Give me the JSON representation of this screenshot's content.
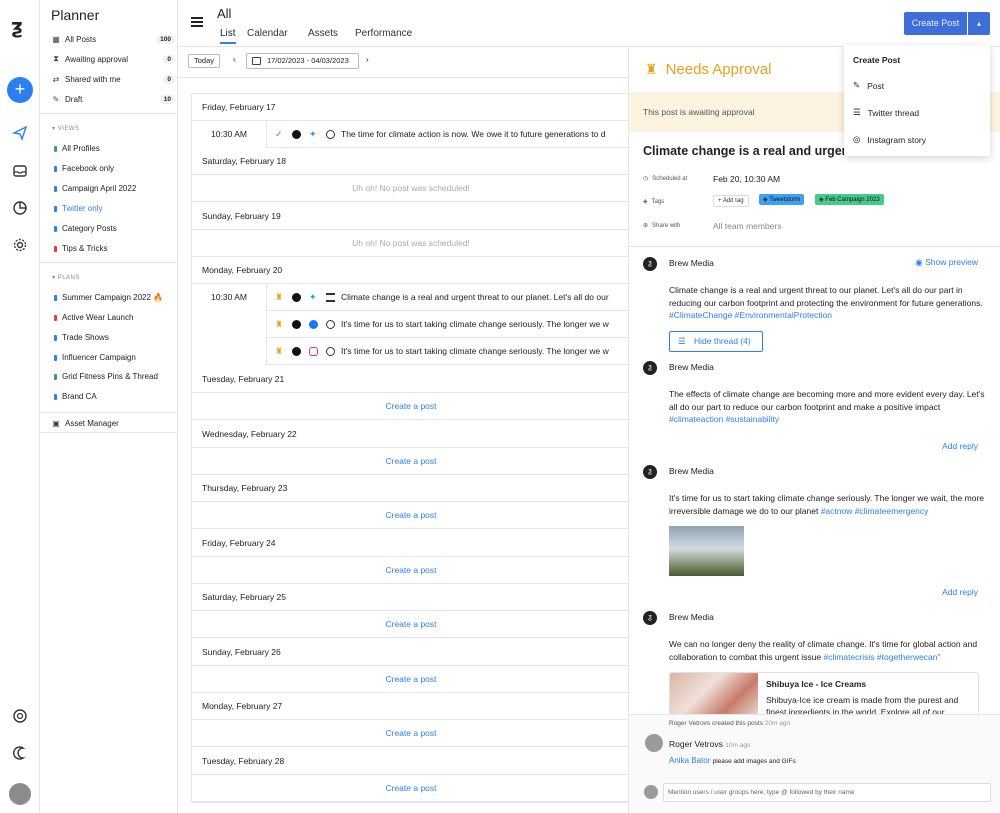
{
  "app": {
    "logo_glyph": "ƺ"
  },
  "sidebar": {
    "title": "Planner",
    "items": [
      {
        "label": "All Posts",
        "count": "100"
      },
      {
        "label": "Awaiting approval",
        "count": "0"
      },
      {
        "label": "Shared with me",
        "count": "0"
      },
      {
        "label": "Draft",
        "count": "10"
      }
    ],
    "views_head": "VIEWS",
    "views": [
      {
        "label": "All Profiles",
        "color": "#3aa35c"
      },
      {
        "label": "Facebook only",
        "color": "#2d7ff0"
      },
      {
        "label": "Campaign April 2022",
        "color": "#2d7ff0"
      },
      {
        "label": "Twitter only",
        "color": "#2d7ff0"
      },
      {
        "label": "Category Posts",
        "color": "#2d7ff0"
      },
      {
        "label": "Tips & Tricks",
        "color": "#e53b3b"
      }
    ],
    "plans_head": "PLANS",
    "plans": [
      {
        "label": "Summer Campaign 2022 🔥",
        "color": "#2d7ff0"
      },
      {
        "label": "Active Wear Launch",
        "color": "#e53b3b"
      },
      {
        "label": "Trade Shows",
        "color": "#2d7ff0"
      },
      {
        "label": "Influencer Campaign",
        "color": "#2d7ff0"
      },
      {
        "label": "Grid Fitness Pins & Thread",
        "color": "#3aa35c"
      },
      {
        "label": "Brand CA",
        "color": "#2d7ff0"
      }
    ],
    "asset_manager": "Asset Manager"
  },
  "header": {
    "title": "All",
    "tabs": [
      "List",
      "Calendar",
      "Assets",
      "Performance"
    ],
    "create_label": "Create Post"
  },
  "toolbar": {
    "today": "Today",
    "date_range": "17/02/2023 - 04/03/2023"
  },
  "days": {
    "fri17": "Friday, February 17",
    "sat18": "Saturday, February 18",
    "sun19": "Sunday, February 19",
    "mon20": "Monday, February 20",
    "tue21": "Tuesday, February 21",
    "wed22": "Wednesday, February 22",
    "thu23": "Thursday, February 23",
    "fri24": "Friday, February 24",
    "sat25": "Saturday, February 25",
    "sun26": "Sunday, February 26",
    "mon27": "Monday, February 27",
    "tue28": "Tuesday, February 28"
  },
  "posts": {
    "p1_time": "10:30 AM",
    "p1_text": "The time for climate action is now. We owe it to future generations to d",
    "p2_time": "10:30 AM",
    "p2_text": "Climate change is a real and urgent threat to our planet. Let's all do our",
    "p3_text": "It's time for us to start taking climate change seriously. The longer we w",
    "p4_text": "It's time for us to start taking climate change seriously. The longer we w"
  },
  "empty_text": "Uh oh! No post was scheduled!",
  "create_text": "Create a post",
  "panel": {
    "status": "Needs Approval",
    "await": "This post is awaiting approval",
    "title": "Climate change is a real and urgent th",
    "scheduled_label": "Scheduled at",
    "scheduled_val": "Feb 20, 10:30 AM",
    "tags_label": "Tags",
    "add_tag": "Add tag",
    "tag1": "Tweetstorm",
    "tag2": "Feb Campaign 2023",
    "share_label": "Share with",
    "share_val": "All team members",
    "show_preview": "Show preview",
    "account": "Brew Media",
    "t1": "Climate change is a real and urgent threat to our planet. Let's all do our part in reducing our carbon footprint and protecting the environment for future generations.",
    "t1_hash": "#ClimateChange #EnvironmentalProtection",
    "hide_thread": "Hide thread (4)",
    "t2": "The effects of climate change are becoming more and more evident every day. Let's all do our part to reduce our carbon footprint and make a positive impact",
    "t2_hash": "#climateaction #sustainability",
    "add_reply": "Add reply",
    "t3": "It's time for us to start taking climate change seriously. The longer we wait, the more irreversible damage we do to our planet",
    "t3_hash": "#actnow #climateemergency",
    "t4": "We can no longer deny the reality of climate change. It's time for global action and collaboration to combat this urgent issue",
    "t4_hash": "#climatecrisis #togetherwecan\"",
    "card_title": "Shibuya Ice - Ice Creams",
    "card_desc": "Shibuya-Ice ice cream is made from the purest and finest ingredients in the world. Explore all of our",
    "activity_user": "Roger Vetrovs",
    "activity": "created this posts",
    "activity_time": "20m ago",
    "comment_user": "Roger Vetrovs",
    "comment_time": "10m ago",
    "mention_user": "Anika Bator",
    "mention_text": "please add images and GIFs",
    "input_placeholder": "Mention users / user groups here, type @ followed by their name"
  },
  "dropdown": {
    "title": "Create Post",
    "items": [
      "Post",
      "Twitter thread",
      "Instagram story"
    ]
  }
}
